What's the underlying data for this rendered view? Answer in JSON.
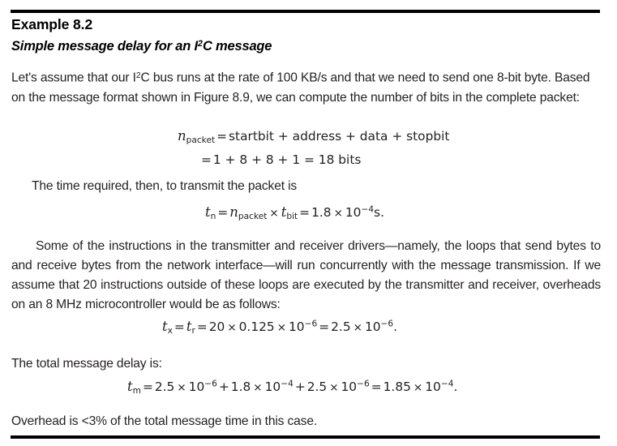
{
  "document": {
    "example_title": "Example 8.2",
    "subtitle": {
      "before": "Simple message delay for an I",
      "sup": "2",
      "after": "C message"
    },
    "paragraphs": {
      "intro": {
        "part1": "Let's assume that our I",
        "sup": "2",
        "part2": "C bus runs at the rate of 100 KB/s and that we need to send one 8-bit byte. Based on the message format shown in Figure 8.9, we can compute the number of bits in the complete packet:"
      },
      "time_required": "The time required, then, to transmit the packet is",
      "some_instructions": "Some of the instructions in the transmitter and receiver drivers—namely, the loops that send bytes to and receive bytes from the network interface—will run concurrently with the message transmission. If we assume that 20 instructions outside of these loops are executed by the transmitter and receiver, overheads on an 8 MHz microcontroller would be as follows:",
      "total_delay": "The total message delay is:",
      "overhead": "Overhead is <3% of the total message time in this case."
    },
    "equations": {
      "packet_def": {
        "lhs_var": "n",
        "lhs_sub": "packet",
        "eq": "=",
        "rhs": "startbit + address + data + stopbit"
      },
      "packet_value": {
        "eq": "=",
        "rhs": "1 + 8 + 8 + 1 = 18 bits"
      },
      "tn": {
        "lhs_var": "t",
        "lhs_sub": "n",
        "eq1": "=",
        "term1_var": "n",
        "term1_sub": "packet",
        "times": "×",
        "term2_var": "t",
        "term2_sub": "bit",
        "eq2": "=",
        "mantissa": "1.8",
        "base": "10",
        "exponent": "−4",
        "unit": "s."
      },
      "tx_tr": {
        "lhs1_var": "t",
        "lhs1_sub": "x",
        "eq1": "=",
        "lhs2_var": "t",
        "lhs2_sub": "r",
        "eq2": "=",
        "factor1": "20",
        "factor2": "0.125",
        "base": "10",
        "exponent": "−6",
        "eq3": "=",
        "result_mantissa": "2.5",
        "result_base": "10",
        "result_exponent": "−6",
        "period": "."
      },
      "tm": {
        "lhs_var": "t",
        "lhs_sub": "m",
        "eq1": "=",
        "t1_mantissa": "2.5",
        "t1_base": "10",
        "t1_exponent": "−6",
        "plus1": "+",
        "t2_mantissa": "1.8",
        "t2_base": "10",
        "t2_exponent": "−4",
        "plus2": "+",
        "t3_mantissa": "2.5",
        "t3_base": "10",
        "t3_exponent": "−6",
        "eq2": "=",
        "result_mantissa": "1.85",
        "result_base": "10",
        "result_exponent": "−4",
        "period": "."
      }
    }
  },
  "colors": {
    "text": "#231f20",
    "heading": "#000000",
    "rule": "#000000",
    "background": "#ffffff"
  }
}
